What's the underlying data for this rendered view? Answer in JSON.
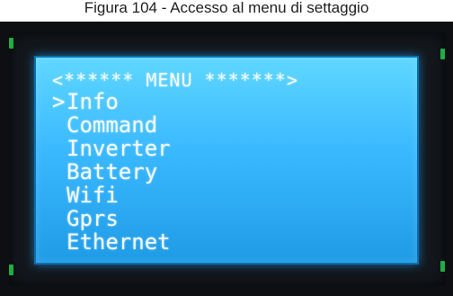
{
  "caption": "Figura 104 - Accesso al menu di settaggio",
  "lcd": {
    "title": "<****** MENU *******>",
    "cursor": ">",
    "items": [
      {
        "label": "Info",
        "selected": true
      },
      {
        "label": "Command",
        "selected": false
      },
      {
        "label": "Inverter",
        "selected": false
      },
      {
        "label": "Battery",
        "selected": false
      },
      {
        "label": "Wifi",
        "selected": false
      },
      {
        "label": "Gprs",
        "selected": false
      },
      {
        "label": "Ethernet",
        "selected": false
      }
    ]
  },
  "colors": {
    "screen": "#3ab9ff",
    "text": "#f4fbff",
    "bezel": "#14181d",
    "pins": "#1fae45"
  }
}
